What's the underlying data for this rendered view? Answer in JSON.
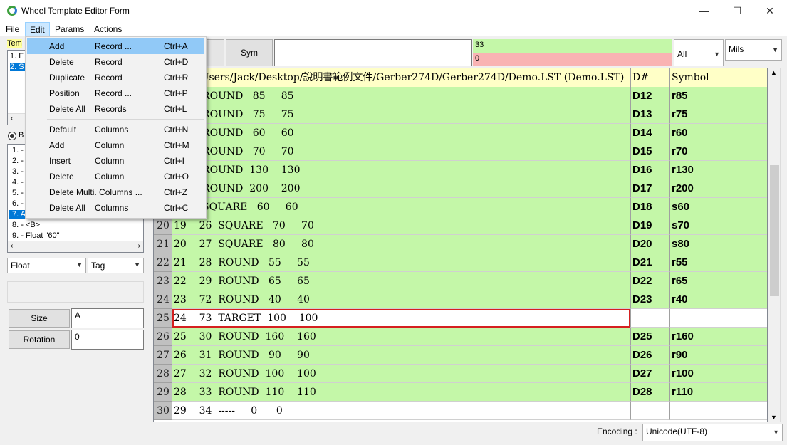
{
  "window": {
    "title": "Wheel Template Editor Form",
    "minimize": "—",
    "maximize": "☐",
    "close": "✕"
  },
  "menubar": [
    "File",
    "Edit",
    "Params",
    "Actions"
  ],
  "left": {
    "template_label": "Tem",
    "template_items": [
      "1. F",
      "2. S"
    ],
    "radio_label": "B",
    "list_items": [
      "1. -",
      "2. -",
      "3. -",
      "4. -",
      "5. -",
      "6. -",
      "7. A",
      "8. -    <B>",
      "9. -    Float        \"60\""
    ],
    "type_combo": "Float",
    "tag_combo": "Tag",
    "size_label": "Size",
    "size_value": "A",
    "rotation_label": "Rotation",
    "rotation_value": "0"
  },
  "toolbar": {
    "sym_button": "Sym",
    "status_top": "33",
    "status_bottom": "0",
    "filter_select": "All",
    "units_select": "Mils"
  },
  "grid": {
    "header_data": "a: C:/Users/Jack/Desktop/說明書範例文件/Gerber274D/Gerber274D/Demo.LST (Demo.LST)",
    "header_dnum": "D#",
    "header_symbol": "Symbol",
    "rows": [
      {
        "num": "",
        "data": "     1  ROUND   85     85",
        "dnum": "D12",
        "sym": "r85",
        "style": "green"
      },
      {
        "num": "",
        "data": "     0  ROUND   75     75",
        "dnum": "D13",
        "sym": "r75",
        "style": "green"
      },
      {
        "num": "",
        "data": "     1  ROUND   60     60",
        "dnum": "D14",
        "sym": "r60",
        "style": "green"
      },
      {
        "num": "",
        "data": "     2  ROUND   70     70",
        "dnum": "D15",
        "sym": "r70",
        "style": "green"
      },
      {
        "num": "",
        "data": "     3  ROUND  130    130",
        "dnum": "D16",
        "sym": "r130",
        "style": "green"
      },
      {
        "num": "",
        "data": "     4  ROUND  200    200",
        "dnum": "D17",
        "sym": "r200",
        "style": "green"
      },
      {
        "num": "",
        "data": "     5  SQUARE   60     60",
        "dnum": "D18",
        "sym": "s60",
        "style": "green"
      },
      {
        "num": "20",
        "data": "19    26  SQUARE   70     70",
        "dnum": "D19",
        "sym": "s70",
        "style": "green"
      },
      {
        "num": "21",
        "data": "20    27  SQUARE   80     80",
        "dnum": "D20",
        "sym": "s80",
        "style": "green"
      },
      {
        "num": "22",
        "data": "21    28  ROUND   55     55",
        "dnum": "D21",
        "sym": "r55",
        "style": "green"
      },
      {
        "num": "23",
        "data": "22    29  ROUND   65     65",
        "dnum": "D22",
        "sym": "r65",
        "style": "green"
      },
      {
        "num": "24",
        "data": "23    72  ROUND   40     40",
        "dnum": "D23",
        "sym": "r40",
        "style": "green"
      },
      {
        "num": "25",
        "data": "24    73  TARGET  100    100",
        "dnum": "",
        "sym": "",
        "style": "white target"
      },
      {
        "num": "26",
        "data": "25    30  ROUND  160    160",
        "dnum": "D25",
        "sym": "r160",
        "style": "green"
      },
      {
        "num": "27",
        "data": "26    31  ROUND   90     90",
        "dnum": "D26",
        "sym": "r90",
        "style": "green"
      },
      {
        "num": "28",
        "data": "27    32  ROUND  100    100",
        "dnum": "D27",
        "sym": "r100",
        "style": "green"
      },
      {
        "num": "29",
        "data": "28    33  ROUND  110    110",
        "dnum": "D28",
        "sym": "r110",
        "style": "green"
      },
      {
        "num": "30",
        "data": "29    34  -----     0      0",
        "dnum": "",
        "sym": "",
        "style": "white"
      }
    ]
  },
  "footer": {
    "encoding_label": "Encoding :",
    "encoding_value": "Unicode(UTF-8)"
  },
  "edit_menu": [
    {
      "a": "Add",
      "b": "Record ...",
      "c": "Ctrl+A",
      "highlight": true
    },
    {
      "a": "Delete",
      "b": "Record",
      "c": "Ctrl+D"
    },
    {
      "a": "Duplicate",
      "b": "Record",
      "c": "Ctrl+R"
    },
    {
      "a": "Position",
      "b": "Record ...",
      "c": "Ctrl+P"
    },
    {
      "a": "Delete All",
      "b": "Records",
      "c": "Ctrl+L"
    },
    {
      "a": "Default",
      "b": "Columns",
      "c": "Ctrl+N"
    },
    {
      "a": "Add",
      "b": "Column",
      "c": "Ctrl+M"
    },
    {
      "a": "Insert",
      "b": "Column",
      "c": "Ctrl+I"
    },
    {
      "a": "Delete",
      "b": "Column",
      "c": "Ctrl+O"
    },
    {
      "a": "Delete Multi. Columns ...",
      "b": "",
      "c": "Ctrl+Z"
    },
    {
      "a": "Delete All",
      "b": "Columns",
      "c": "Ctrl+C"
    }
  ]
}
